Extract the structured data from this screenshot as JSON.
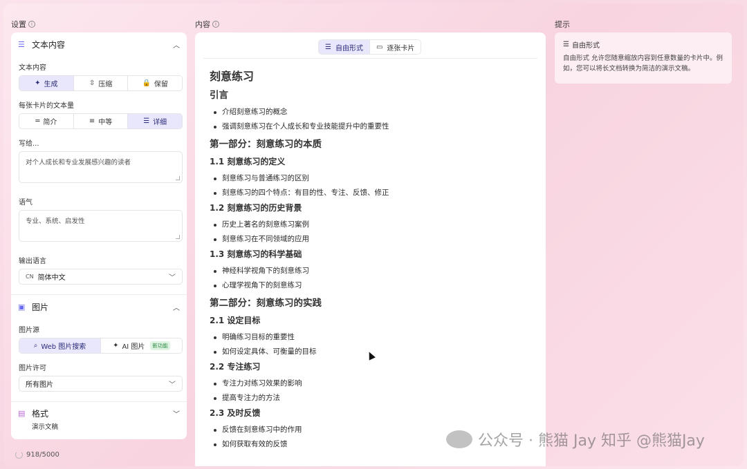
{
  "columns": {
    "settings": "设置",
    "content": "内容",
    "hints": "提示"
  },
  "left": {
    "text_section": {
      "title": "文本内容",
      "text_content_label": "文本内容",
      "text_modes": [
        {
          "icon": "sparkle-icon",
          "glyph": "✦",
          "label": "生成",
          "active": true
        },
        {
          "icon": "compress-icon",
          "glyph": "⇳",
          "label": "压缩",
          "active": false
        },
        {
          "icon": "lock-icon",
          "glyph": "🔒",
          "label": "保留",
          "active": false
        }
      ],
      "amount_label": "每张卡片的文本量",
      "amount_options": [
        {
          "icon": "brief-icon",
          "glyph": "═",
          "label": "简介",
          "active": false
        },
        {
          "icon": "medium-icon",
          "glyph": "≡",
          "label": "中等",
          "active": false
        },
        {
          "icon": "detailed-icon",
          "glyph": "☰",
          "label": "详细",
          "active": true
        }
      ],
      "audience_label": "写给...",
      "audience_value": "对个人成长和专业发展感兴趣的读者",
      "tone_label": "语气",
      "tone_value": "专业、系统、启发性",
      "language_label": "输出语言",
      "language_flag": "CN",
      "language_value": "简体中文"
    },
    "image_section": {
      "title": "图片",
      "source_label": "图片源",
      "sources": [
        {
          "icon": "search-icon",
          "glyph": "⌕",
          "label": "Web 图片搜索",
          "active": true
        },
        {
          "icon": "ai-sparkle-icon",
          "glyph": "✦",
          "label": "AI 图片",
          "badge": "新功能",
          "active": false
        }
      ],
      "license_label": "图片许可",
      "license_value": "所有图片"
    },
    "format_section": {
      "title": "格式",
      "value": "演示文稿"
    },
    "status": "918/5000"
  },
  "middle": {
    "modes": [
      {
        "icon": "free-form-icon",
        "glyph": "☰",
        "label": "自由形式",
        "active": true
      },
      {
        "icon": "card-icon",
        "glyph": "▭",
        "label": "逐张卡片",
        "active": false
      }
    ],
    "doc": {
      "title": "刻意练习",
      "intro_heading": "引言",
      "intro_items": [
        "介绍刻意练习的概念",
        "强调刻意练习在个人成长和专业技能提升中的重要性"
      ],
      "part1_heading": "第一部分：刻意练习的本质",
      "s11": "1.1 刻意练习的定义",
      "s11_items": [
        "刻意练习与普通练习的区别",
        "刻意练习的四个特点：有目的性、专注、反馈、修正"
      ],
      "s12": "1.2 刻意练习的历史背景",
      "s12_items": [
        "历史上著名的刻意练习案例",
        "刻意练习在不同领域的应用"
      ],
      "s13": "1.3 刻意练习的科学基础",
      "s13_items": [
        "神经科学视角下的刻意练习",
        "心理学视角下的刻意练习"
      ],
      "part2_heading": "第二部分：刻意练习的实践",
      "s21": "2.1 设定目标",
      "s21_items": [
        "明确练习目标的重要性",
        "如何设定具体、可衡量的目标"
      ],
      "s22": "2.2 专注练习",
      "s22_items": [
        "专注力对练习效果的影响",
        "提高专注力的方法"
      ],
      "s23": "2.3 及时反馈",
      "s23_items": [
        "反馈在刻意练习中的作用",
        "如何获取有效的反馈"
      ]
    }
  },
  "right": {
    "hint_title": "自由形式",
    "hint_text": "自由形式 允许您随意缩放内容到任意数量的卡片中。例如，您可以将长文档转换为简洁的演示文稿。"
  },
  "watermark": "公众号 · 熊猫 Jay 知乎 @熊猫Jay"
}
